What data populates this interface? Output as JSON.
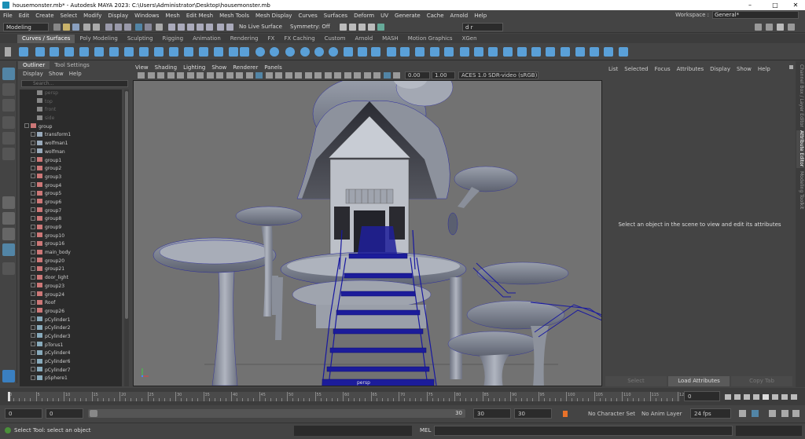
{
  "window": {
    "title": "housemonster.mb* - Autodesk MAYA 2023: C:\\Users\\Administrator\\Desktop\\housemonster.mb",
    "minimize": "–",
    "maximize": "□",
    "close": "✕"
  },
  "menubar": {
    "items": [
      "File",
      "Edit",
      "Create",
      "Select",
      "Modify",
      "Display",
      "Windows",
      "Mesh",
      "Edit Mesh",
      "Mesh Tools",
      "Mesh Display",
      "Curves",
      "Surfaces",
      "Deform",
      "UV",
      "Generate",
      "Cache",
      "Arnold",
      "Help"
    ],
    "workspace_label": "Workspace :",
    "workspace_value": "General*"
  },
  "statusline": {
    "mode": "Modeling",
    "live_surface": "No Live Surface",
    "symmetry": "Symmetry: Off",
    "camera_field": "d r"
  },
  "shelf": {
    "tabs": [
      "Curves / Surfaces",
      "Poly Modeling",
      "Sculpting",
      "Rigging",
      "Animation",
      "Rendering",
      "FX",
      "FX Caching",
      "Custom",
      "Arnold",
      "MASH",
      "Motion Graphics",
      "XGen"
    ],
    "active_tab": "Curves / Surfaces"
  },
  "outliner": {
    "tabs": [
      "Outliner",
      "Tool Settings"
    ],
    "menu": [
      "Display",
      "Show",
      "Help"
    ],
    "search_placeholder": "Search...",
    "items": [
      {
        "label": "persp",
        "kind": "camera",
        "dim": true,
        "expand": false,
        "indent": 1
      },
      {
        "label": "top",
        "kind": "camera",
        "dim": true,
        "expand": false,
        "indent": 1
      },
      {
        "label": "front",
        "kind": "camera",
        "dim": true,
        "expand": false,
        "indent": 1
      },
      {
        "label": "side",
        "kind": "camera",
        "dim": true,
        "expand": false,
        "indent": 1
      },
      {
        "label": "group",
        "kind": "group",
        "dim": false,
        "expand": true,
        "indent": 0
      },
      {
        "label": "transform1",
        "kind": "transform",
        "dim": false,
        "expand": true,
        "indent": 1
      },
      {
        "label": "wolfman1",
        "kind": "transform",
        "dim": false,
        "expand": true,
        "indent": 1
      },
      {
        "label": "wolfman",
        "kind": "transform",
        "dim": false,
        "expand": true,
        "indent": 1
      },
      {
        "label": "group1",
        "kind": "group",
        "dim": false,
        "expand": true,
        "indent": 1
      },
      {
        "label": "group2",
        "kind": "group",
        "dim": false,
        "expand": true,
        "indent": 1
      },
      {
        "label": "group3",
        "kind": "group",
        "dim": false,
        "expand": true,
        "indent": 1
      },
      {
        "label": "group4",
        "kind": "group",
        "dim": false,
        "expand": true,
        "indent": 1
      },
      {
        "label": "group5",
        "kind": "group",
        "dim": false,
        "expand": true,
        "indent": 1
      },
      {
        "label": "group6",
        "kind": "group",
        "dim": false,
        "expand": true,
        "indent": 1
      },
      {
        "label": "group7",
        "kind": "group",
        "dim": false,
        "expand": true,
        "indent": 1
      },
      {
        "label": "group8",
        "kind": "group",
        "dim": false,
        "expand": true,
        "indent": 1
      },
      {
        "label": "group9",
        "kind": "group",
        "dim": false,
        "expand": true,
        "indent": 1
      },
      {
        "label": "group10",
        "kind": "group",
        "dim": false,
        "expand": true,
        "indent": 1
      },
      {
        "label": "group16",
        "kind": "group",
        "dim": false,
        "expand": true,
        "indent": 1
      },
      {
        "label": "main_body",
        "kind": "group",
        "dim": false,
        "expand": true,
        "indent": 1
      },
      {
        "label": "group20",
        "kind": "group",
        "dim": false,
        "expand": true,
        "indent": 1
      },
      {
        "label": "group21",
        "kind": "group",
        "dim": false,
        "expand": true,
        "indent": 1
      },
      {
        "label": "door_light",
        "kind": "group",
        "dim": false,
        "expand": true,
        "indent": 1
      },
      {
        "label": "group23",
        "kind": "group",
        "dim": false,
        "expand": true,
        "indent": 1
      },
      {
        "label": "group24",
        "kind": "group",
        "dim": false,
        "expand": true,
        "indent": 1
      },
      {
        "label": "Roof",
        "kind": "group",
        "dim": false,
        "expand": true,
        "indent": 1
      },
      {
        "label": "group26",
        "kind": "group",
        "dim": false,
        "expand": true,
        "indent": 1
      },
      {
        "label": "pCylinder1",
        "kind": "mesh",
        "dim": false,
        "expand": true,
        "indent": 1
      },
      {
        "label": "pCylinder2",
        "kind": "mesh",
        "dim": false,
        "expand": true,
        "indent": 1
      },
      {
        "label": "pCylinder3",
        "kind": "mesh",
        "dim": false,
        "expand": true,
        "indent": 1
      },
      {
        "label": "pTorus1",
        "kind": "mesh",
        "dim": false,
        "expand": true,
        "indent": 1
      },
      {
        "label": "pCylinder4",
        "kind": "mesh",
        "dim": false,
        "expand": true,
        "indent": 1
      },
      {
        "label": "pCylinder6",
        "kind": "mesh",
        "dim": false,
        "expand": true,
        "indent": 1
      },
      {
        "label": "pCylinder7",
        "kind": "mesh",
        "dim": false,
        "expand": true,
        "indent": 1
      },
      {
        "label": "pSphere1",
        "kind": "mesh",
        "dim": false,
        "expand": true,
        "indent": 1
      }
    ]
  },
  "viewport": {
    "menu": [
      "View",
      "Shading",
      "Lighting",
      "Show",
      "Renderer",
      "Panels"
    ],
    "exposure": "0.00",
    "gamma": "1.00",
    "colorspace": "ACES 1.0 SDR-video (sRGB)",
    "camera_label": "persp"
  },
  "attribute_editor": {
    "menu": [
      "List",
      "Selected",
      "Focus",
      "Attributes",
      "Display",
      "Show",
      "Help"
    ],
    "message": "Select an object in the scene to view and edit its attributes",
    "buttons": [
      "Select",
      "Load Attributes",
      "Copy Tab"
    ],
    "side_tabs": [
      "Channel Box / Layer Editor",
      "Attribute Editor",
      "Modeling Toolkit"
    ],
    "active_side_tab": "Attribute Editor"
  },
  "timeline": {
    "ticks": [
      0,
      5,
      10,
      15,
      20,
      25,
      30,
      35,
      40,
      45,
      50,
      55,
      60,
      65,
      70,
      75,
      80,
      85,
      90,
      95,
      100,
      105,
      110,
      115,
      120
    ],
    "current_frame": "0"
  },
  "range": {
    "start": "0",
    "anim_start": "0",
    "slider_end": "30",
    "range_end": "30",
    "anim_end": "30",
    "character_set": "No Character Set",
    "anim_layer": "No Anim Layer",
    "fps": "24 fps"
  },
  "status": {
    "help_line": "Select Tool: select an object",
    "language": "MEL"
  },
  "colors": {
    "accent": "#5285a6",
    "wire": "#1a1aa0",
    "viewport_bg": "#727272"
  }
}
